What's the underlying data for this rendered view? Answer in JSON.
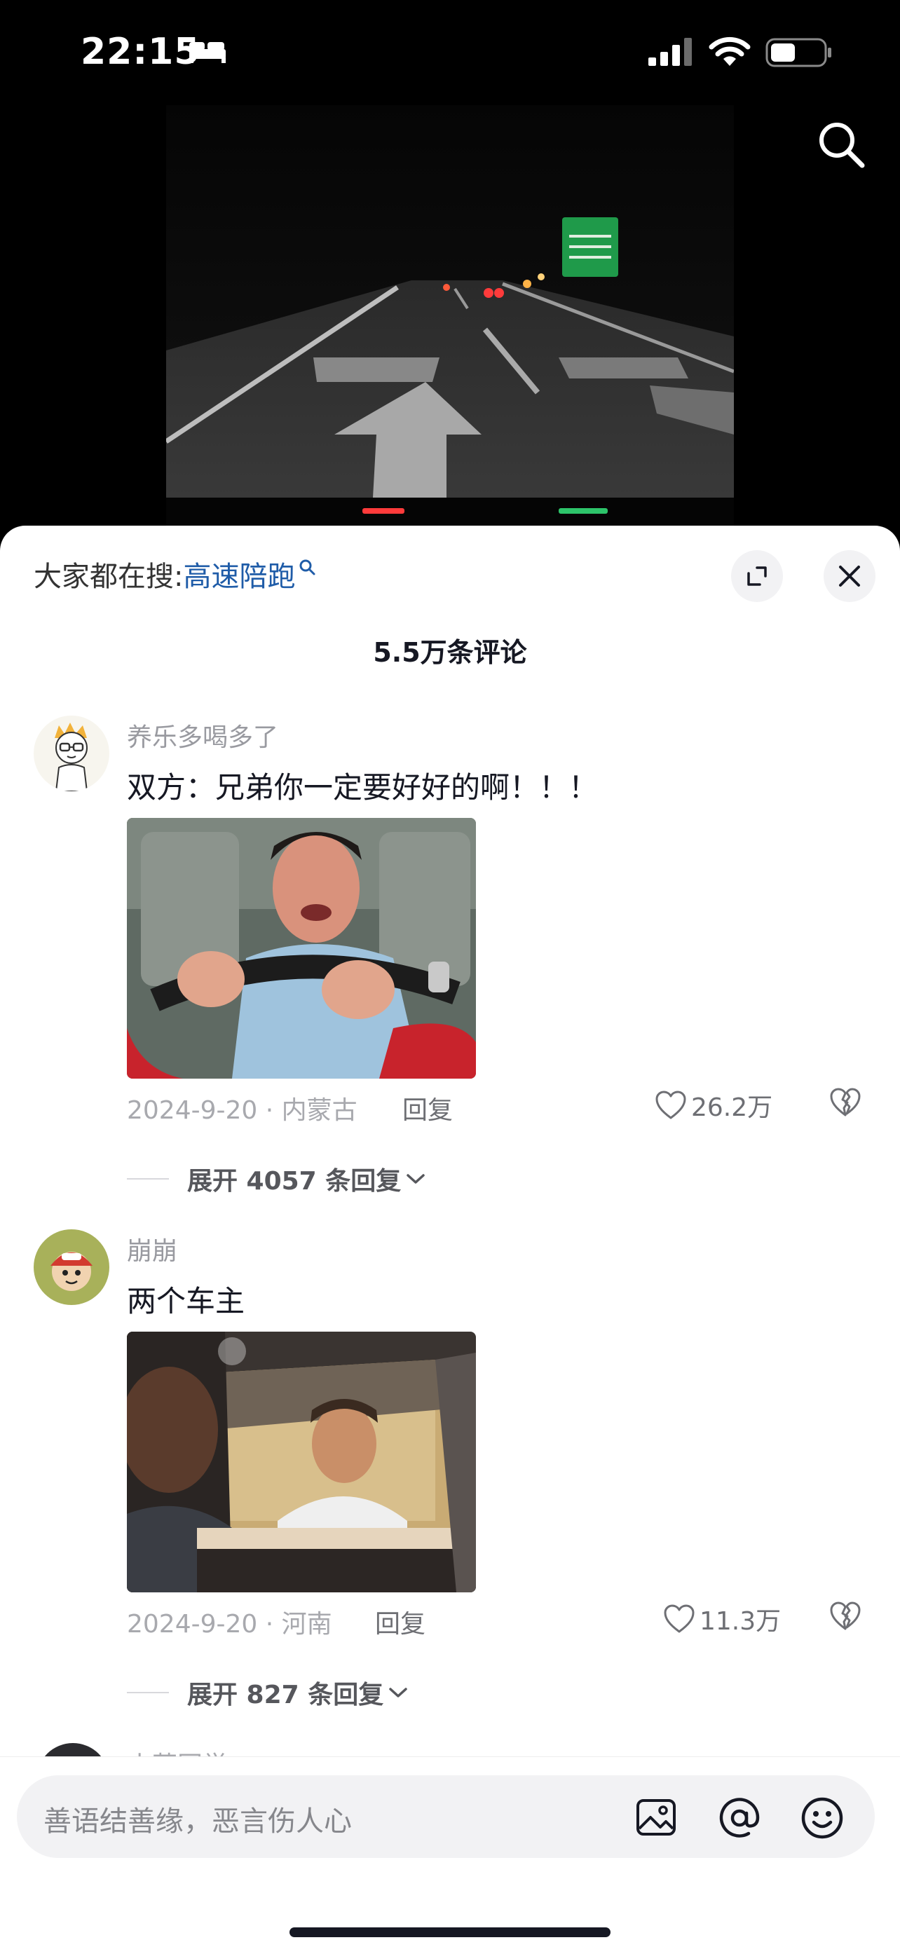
{
  "status_bar": {
    "time": "22:15"
  },
  "hot_search": {
    "prefix": "大家都在搜:",
    "keyword": "高速陪跑"
  },
  "comments_count": "5.5万条评论",
  "comments": [
    {
      "username": "养乐多喝多了",
      "text": "双方：兄弟你一定要好好的啊！！！",
      "meta": "2024-9-20 · 内蒙古",
      "reply_label": "回复",
      "likes": "26.2万",
      "expand_label": "展开 4057 条回复"
    },
    {
      "username": "崩崩",
      "text": "两个车主",
      "meta": "2024-9-20 · 河南",
      "reply_label": "回复",
      "likes": "11.3万",
      "expand_label": "展开 827 条回复"
    }
  ],
  "partial_comment": {
    "username": "小草同学"
  },
  "input": {
    "placeholder": "善语结善缘，恶言伤人心"
  },
  "icons": {
    "search": "search-icon",
    "expand": "expand-icon",
    "close": "close-icon",
    "like": "heart-icon",
    "dislike": "broken-heart-icon",
    "image": "image-icon",
    "mention": "at-icon",
    "emoji": "emoji-icon"
  },
  "colors": {
    "keyword": "#1f5ca8",
    "sheet": "#ffffff",
    "text": "#161823"
  }
}
